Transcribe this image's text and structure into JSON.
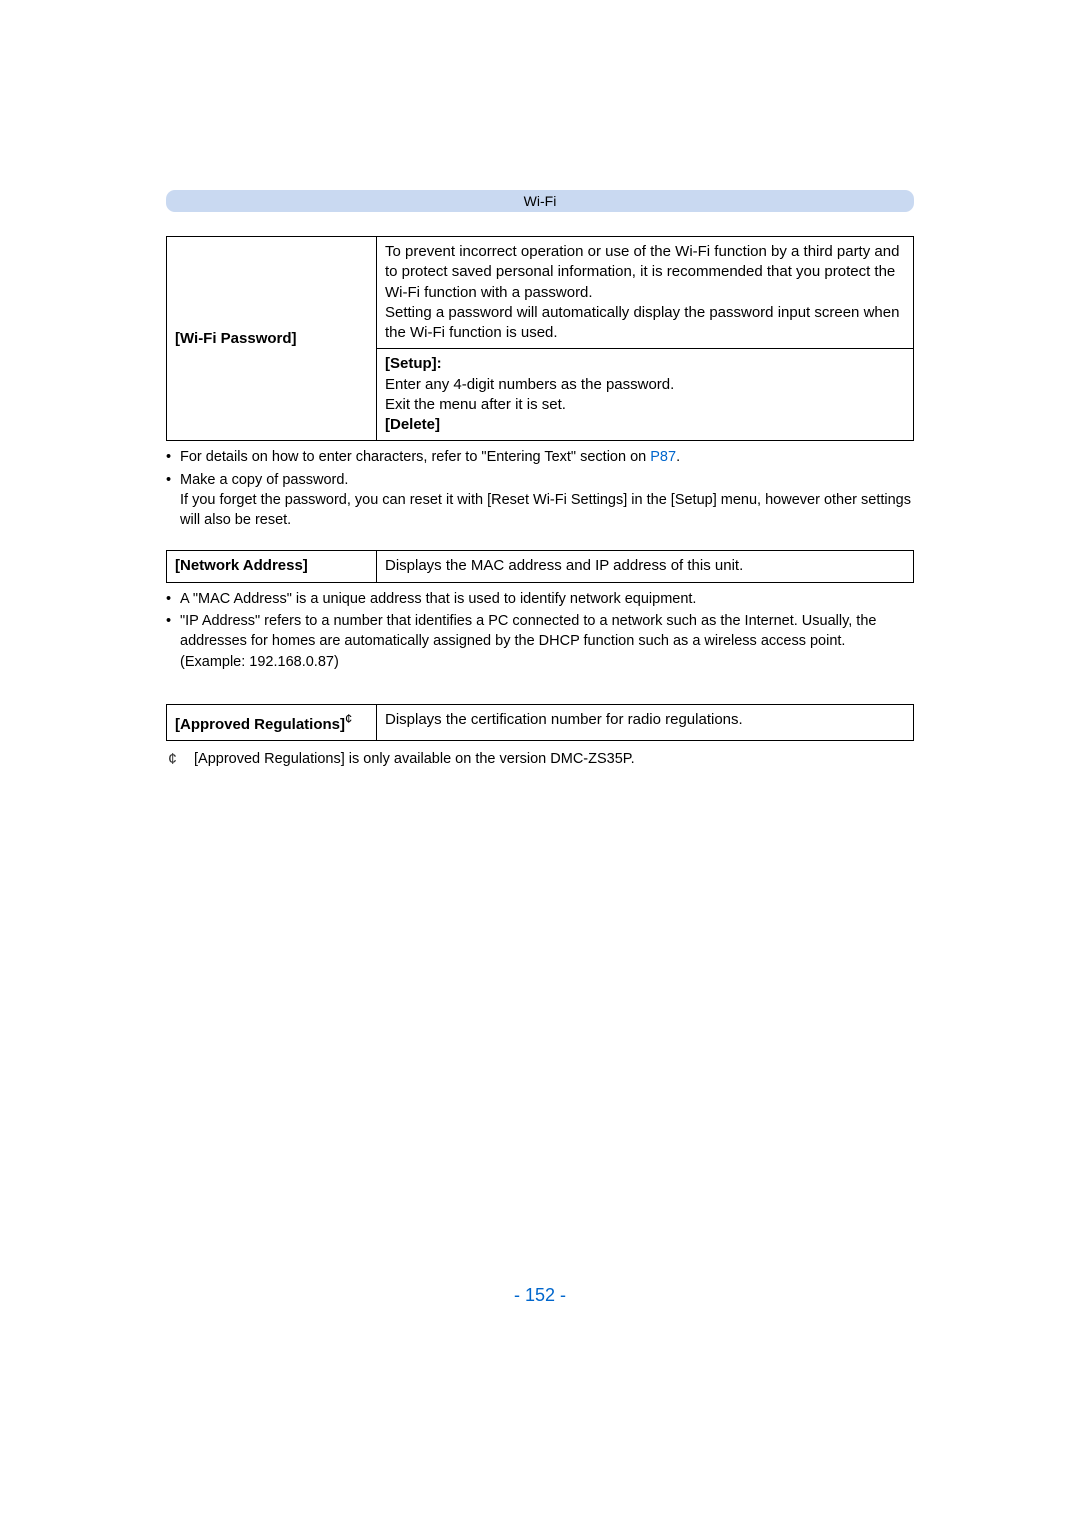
{
  "header": {
    "title": "Wi-Fi"
  },
  "table1": {
    "label": "[Wi-Fi Password]",
    "row1": "To prevent incorrect operation or use of the Wi-Fi function by a third party and to protect saved personal information, it is recommended that you protect the Wi-Fi function with a password.\nSetting a password will automatically display the password input screen when the Wi-Fi function is used.",
    "row2_setup_label": "[Setup]:",
    "row2_setup_text": "Enter any 4-digit numbers as the password.\nExit the menu after it is set.",
    "row2_delete": "[Delete]"
  },
  "notes1": {
    "item1_prefix": "For details on how to enter characters, refer to \"Entering Text\" section on ",
    "item1_link": "P87",
    "item1_suffix": ".",
    "item2_line1": "Make a copy of password.",
    "item2_line2": "If you forget the password, you can reset it with [Reset Wi-Fi Settings] in the [Setup] menu, however other settings will also be reset."
  },
  "table2": {
    "label": "[Network Address]",
    "desc": "Displays the MAC address and IP address of this unit."
  },
  "notes2": {
    "item1": "A \"MAC Address\" is a unique address that is used to identify network equipment.",
    "item2": "\"IP Address\" refers to a number that identifies a PC connected to a network such as the Internet. Usually, the addresses for homes are automatically assigned by the DHCP function such as a wireless access point. (Example: 192.168.0.87)"
  },
  "table3": {
    "label_prefix": "[Approved Regulations]",
    "label_star": "¢",
    "desc": "Displays the certification number for radio regulations."
  },
  "footnote": {
    "star": "¢",
    "text": "[Approved Regulations] is only available on the version DMC-ZS35P."
  },
  "pageNumber": "- 152 -"
}
